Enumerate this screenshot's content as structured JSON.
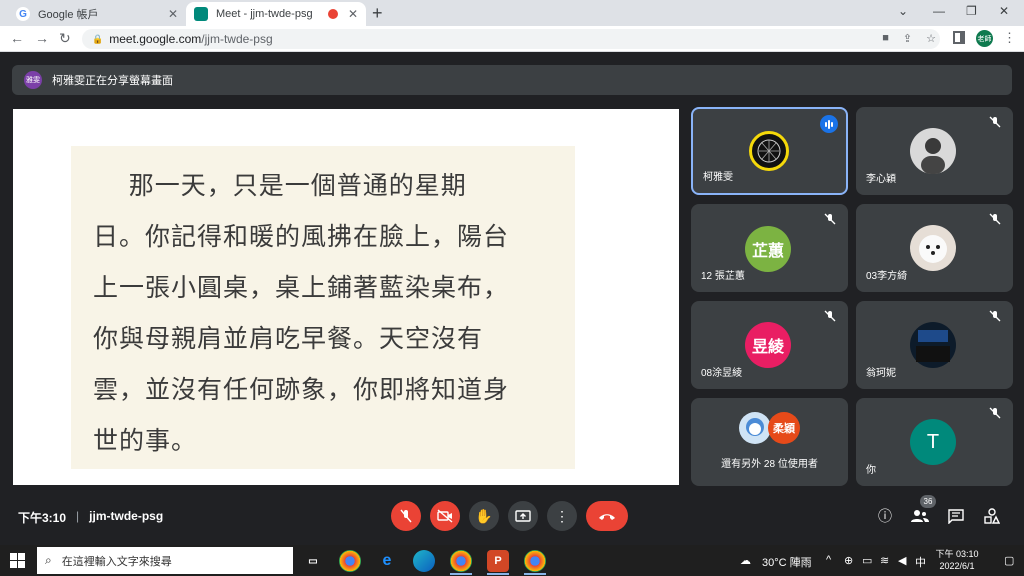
{
  "browser": {
    "tabs": [
      {
        "label": "Google 帳戶"
      },
      {
        "label": "Meet - jjm-twde-psg"
      }
    ],
    "url_host": "meet.google.com",
    "url_path": "/jjm-twde-psg",
    "profile_label": "老師"
  },
  "meet": {
    "banner_chip": "雅雯",
    "banner_text": "柯雅雯正在分享螢幕畫面",
    "slide_lines": [
      "    那一天，只是一個普通的星期",
      "日。你記得和暖的風拂在臉上，陽台",
      "上一張小圓桌，桌上鋪著藍染桌布，",
      "你與母親肩並肩吃早餐。天空沒有",
      "雲，並沒有任何跡象，你即將知道身",
      "世的事。"
    ],
    "participants": [
      {
        "name": "柯雅雯",
        "avatar": ""
      },
      {
        "name": "李心穎",
        "avatar": ""
      },
      {
        "name": "12 張芷蕙",
        "avatar": "芷蕙",
        "color": "#7cb342"
      },
      {
        "name": "03李方綺",
        "avatar": ""
      },
      {
        "name": "08涂昱綾",
        "avatar": "昱綾",
        "color": "#e91e63"
      },
      {
        "name": "翁珂妮",
        "avatar": ""
      },
      {
        "name": "還有另外 28 位使用者",
        "avatar": "柔穎",
        "color": "#e64a19"
      },
      {
        "name": "你",
        "avatar": "T",
        "color": "#00897b"
      }
    ],
    "time": "下午3:10",
    "meeting_code": "jjm-twde-psg",
    "people_count": "36"
  },
  "taskbar": {
    "search_placeholder": "在這裡輸入文字來搜尋",
    "weather": "30°C 陣雨",
    "ime": "中",
    "clock_time": "下午 03:10",
    "clock_date": "2022/6/1"
  }
}
